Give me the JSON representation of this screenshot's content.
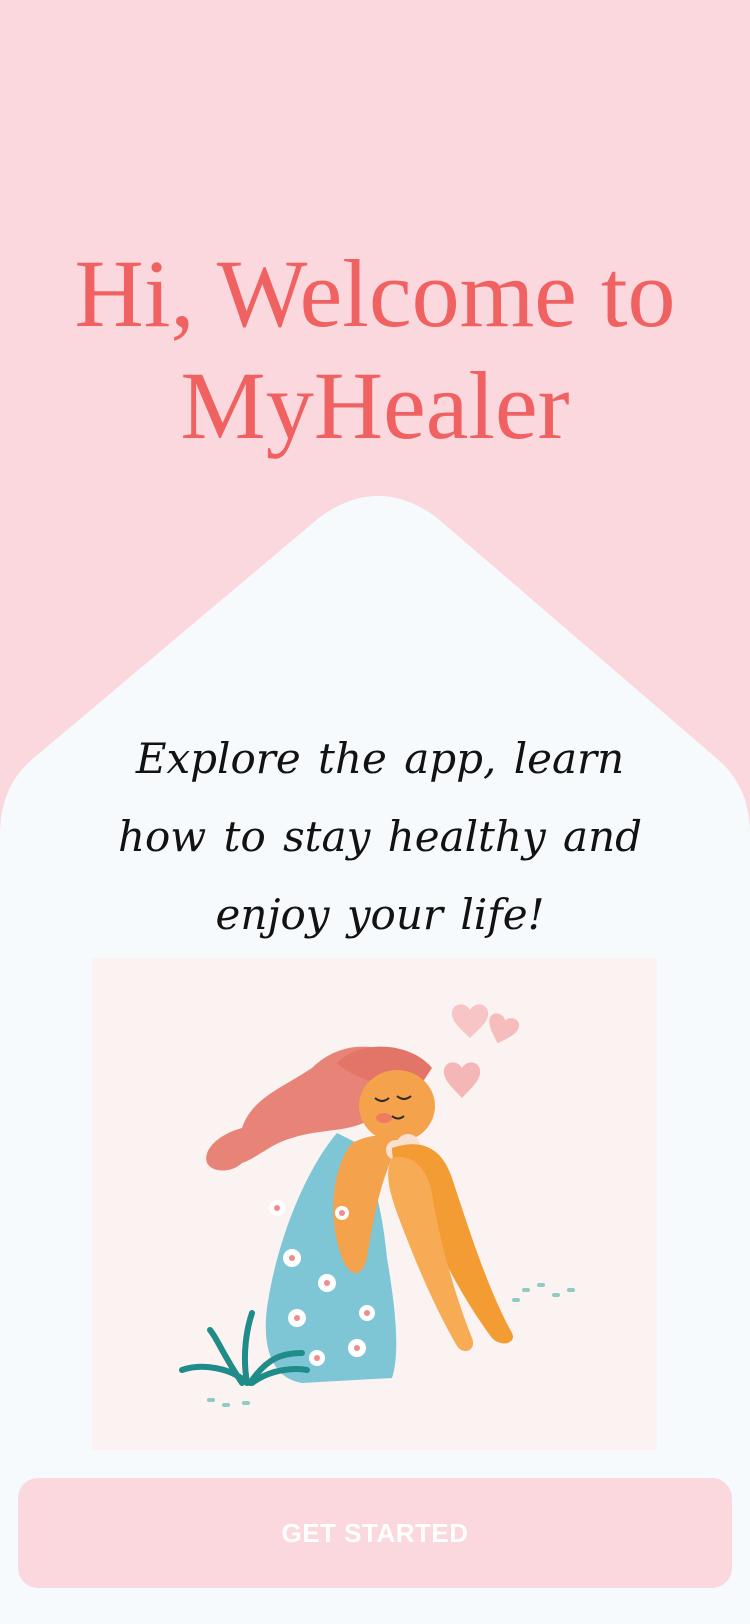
{
  "welcome": {
    "line1": "Hi, Welcome to",
    "line2": "MyHealer"
  },
  "tagline": "Explore the app, learn how to stay healthy and enjoy your life!",
  "illustration": {
    "icon": "woman-sitting-with-hearts-illustration"
  },
  "cta": {
    "label": "GET STARTED"
  },
  "colors": {
    "background": "#FBD8DE",
    "panel": "#F7FAFD",
    "title": "#F06262",
    "button": "#FBD8DE",
    "button_text": "#FFFFFF"
  }
}
